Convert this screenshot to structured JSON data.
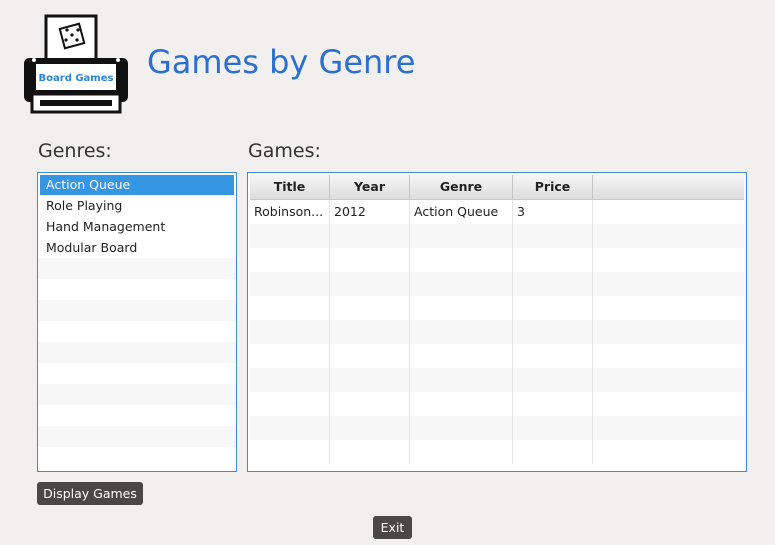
{
  "app": {
    "title": "Games by Genre",
    "logo_text": "Board Games"
  },
  "genres": {
    "label": "Genres:",
    "items": [
      "Action Queue",
      "Role Playing",
      "Hand Management",
      "Modular Board"
    ],
    "selected": "Action Queue"
  },
  "games": {
    "label": "Games:",
    "columns": [
      "Title",
      "Year",
      "Genre",
      "Price"
    ],
    "rows": [
      [
        "Robinson...",
        "2012",
        "Action Queue",
        "3"
      ]
    ]
  },
  "buttons": {
    "display": "Display Games",
    "exit": "Exit"
  },
  "colors": {
    "title": "#2b6fd1",
    "selection": "#3596e4",
    "border": "#3d8fc9",
    "button": "#4a4845"
  }
}
